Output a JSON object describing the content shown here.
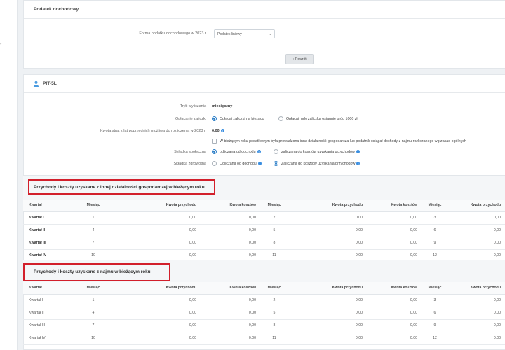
{
  "sidebar": {
    "marks": [
      "y"
    ]
  },
  "income_tax": {
    "title": "Podatek dochodowy",
    "form_label": "Forma podatku dochodowego w 2023 r.",
    "form_value": "Podatek liniowy",
    "back_button": "Powrót"
  },
  "pit": {
    "title": "PIT-5L",
    "mode_label": "Tryb wyliczania",
    "mode_value": "miesięczny",
    "advance_label": "Opłacanie zaliczki",
    "advance_opt1": "Opłacaj zaliczki na bieżąco",
    "advance_opt2": "Opłacaj, gdy zaliczka osiągnie próg 1000 zł",
    "loss_label": "Kwota strat z lat poprzednich możliwa do rozliczenia w 2023 r.",
    "loss_value": "0,00",
    "checkbox_text": "W bieżącym roku podatkowym była prowadzona inna działalność gospodarcza lub podatnik osiągał dochody z najmu rozliczanego wg zasad ogólnych",
    "social_label": "Składka społeczna",
    "social_opt1": "odliczana od dochodu",
    "social_opt2": "zaliczana do kosztów uzyskania przychodów",
    "health_label": "Składka zdrowotna",
    "health_opt1": "Odliczana od dochodu",
    "health_opt2": "Zaliczana do kosztów uzyskania przychodów"
  },
  "table_headers": {
    "kwartal": "Kwartał",
    "miesiac": "Miesiąc",
    "przychod": "Kwota przychodu",
    "koszt": "Kwota kosztów",
    "miesiac2": "Miesiąc",
    "przychod2": "Kwota przychodu",
    "koszt2": "Kwota kosztów",
    "miesiac3": "Miesiąc",
    "przychod3": "Kwota przychodu"
  },
  "section1": {
    "title": "Przychody i koszty uzyskane z innej działalności gospodarczej w bieżącym roku",
    "rows": [
      {
        "kw": "Kwartał I",
        "m1": "1",
        "p1": "0,00",
        "k1": "0,00",
        "m2": "2",
        "p2": "0,00",
        "k2": "0,00",
        "m3": "3",
        "p3": "0,00"
      },
      {
        "kw": "Kwartał II",
        "m1": "4",
        "p1": "0,00",
        "k1": "0,00",
        "m2": "5",
        "p2": "0,00",
        "k2": "0,00",
        "m3": "6",
        "p3": "0,00"
      },
      {
        "kw": "Kwartał III",
        "m1": "7",
        "p1": "0,00",
        "k1": "0,00",
        "m2": "8",
        "p2": "0,00",
        "k2": "0,00",
        "m3": "9",
        "p3": "0,00"
      },
      {
        "kw": "Kwartał IV",
        "m1": "10",
        "p1": "0,00",
        "k1": "0,00",
        "m2": "11",
        "p2": "0,00",
        "k2": "0,00",
        "m3": "12",
        "p3": "0,00"
      }
    ]
  },
  "section2": {
    "title": "Przychody i koszty uzyskane z najmu w bieżącym roku",
    "rows": [
      {
        "kw": "Kwartał I",
        "m1": "1",
        "p1": "0,00",
        "k1": "0,00",
        "m2": "2",
        "p2": "0,00",
        "k2": "0,00",
        "m3": "3",
        "p3": "0,00"
      },
      {
        "kw": "Kwartał II",
        "m1": "4",
        "p1": "0,00",
        "k1": "0,00",
        "m2": "5",
        "p2": "0,00",
        "k2": "0,00",
        "m3": "6",
        "p3": "0,00"
      },
      {
        "kw": "Kwartał III",
        "m1": "7",
        "p1": "0,00",
        "k1": "0,00",
        "m2": "8",
        "p2": "0,00",
        "k2": "0,00",
        "m3": "9",
        "p3": "0,00"
      },
      {
        "kw": "Kwartał IV",
        "m1": "10",
        "p1": "0,00",
        "k1": "0,00",
        "m2": "11",
        "p2": "0,00",
        "k2": "0,00",
        "m3": "12",
        "p3": "0,00"
      }
    ]
  },
  "colors": {
    "accent": "#2f80c8",
    "highlight": "#d21f2b"
  }
}
